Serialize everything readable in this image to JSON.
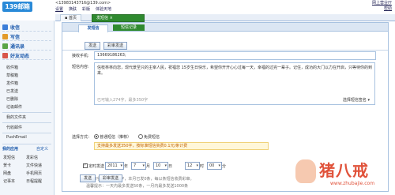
{
  "app": {
    "logo": "139邮箱",
    "account": "<13983143716@139.com>"
  },
  "top_menu": [
    "设置",
    "换肤",
    "彩版",
    "体验天地"
  ],
  "top_links": [
    "网上营业厅",
    "帮助"
  ],
  "tabs": {
    "home": "首页",
    "sms": "发短信"
  },
  "sidebar": {
    "big_items": [
      "收信",
      "写信",
      "通讯录",
      "好友动态"
    ],
    "mail_items": [
      "收件箱",
      "草稿箱",
      "发件箱",
      "已发送",
      "已删除",
      "垃圾邮件"
    ],
    "my_folders": "我的文件夹",
    "agent_folders": "代收邮件",
    "push": "PushEmail",
    "apps_title": "我的应用",
    "apps_custom": "自定义",
    "apps": [
      "发短信",
      "发彩信",
      "贺卡",
      "文件快递",
      "网盘",
      "手机网页",
      "记事本",
      "日程提醒"
    ]
  },
  "main": {
    "subtabs": {
      "send": "发短信",
      "record": "短信记录"
    },
    "buttons": {
      "send": "发送",
      "timed_send": "彩审发送"
    },
    "recipient_label": "接收手机:",
    "recipient_value": "13669186263;",
    "content_label": "短信内容:",
    "content_text": "信枝林林向您，现代景至只的主宰人民，祝福您 15岁生日快乐，希望你开开心心过每一天，幸福的过完一辈子。记住，成功的大门以力在开启，只等待你的到来。",
    "char_count": "已可输入274字，最多350字",
    "signature": "选择短信签名",
    "mode_label": "选择方式：",
    "mode_options": [
      "普通短信（推荐）",
      "免费短信"
    ],
    "warning": "支持最多发送350字，按标准短信资费0.1元/条计费",
    "timed_label": "定时发送",
    "year": "2011",
    "year_unit": "年",
    "month": "7",
    "month_unit": "月",
    "day": "10",
    "day_unit": "日",
    "hour": "12",
    "hour_unit": "时",
    "minute": "00",
    "minute_unit": "分",
    "note1": "本月共78字，每以之条字，本月已发0条，每以条短信收费彩审。",
    "note2": "温馨提示：一天内最多发送50条，一月内最多发送1000条"
  },
  "watermark": {
    "text": "猪八戒",
    "url": "www.zhubajie.com"
  },
  "colors": {
    "accent": "#1f5cad",
    "green_tab": "#2f8a2f",
    "warning": "#c06000"
  }
}
